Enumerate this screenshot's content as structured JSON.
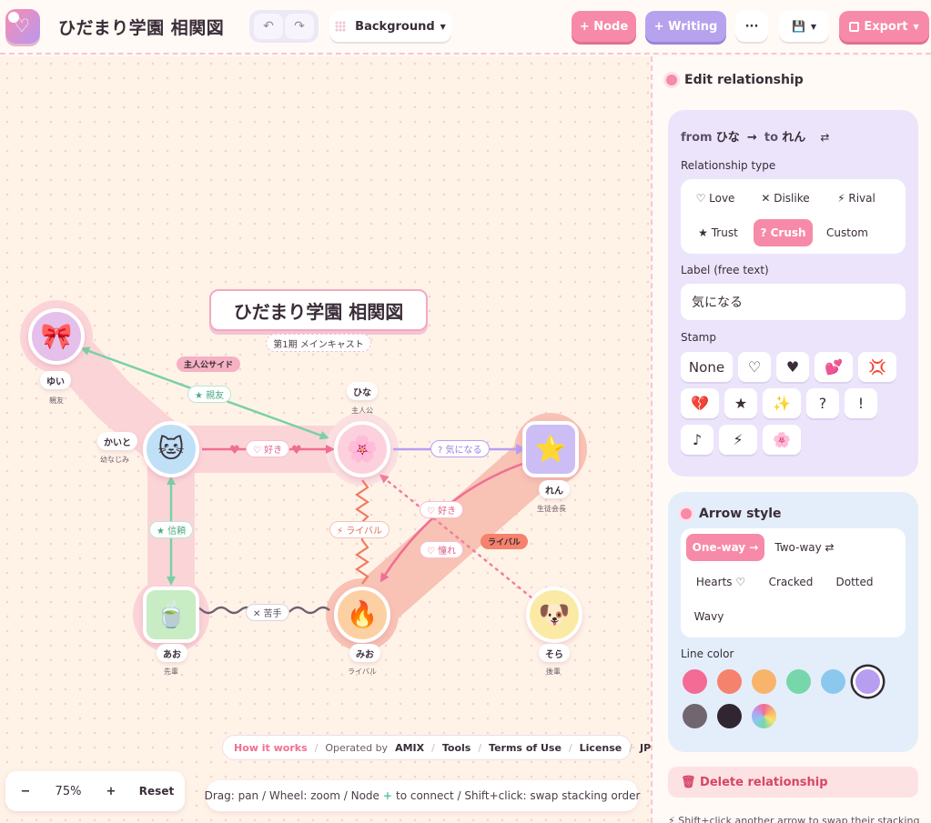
{
  "header": {
    "app_title": "ひだまり学園 相関図",
    "undo_icon": "↶",
    "redo_icon": "↷",
    "background_label": "Background",
    "add_node_label": "+ Node",
    "add_writing_label": "+ Writing",
    "more_label": "···",
    "save_icon": "💾",
    "export_label": "Export"
  },
  "canvas": {
    "title": "ひだまり学園 相関図",
    "subtitle": "第1期 メインキャスト",
    "group_labels": {
      "protagonist_side": "主人公サイド",
      "rival_group": "ライバル"
    },
    "nodes": [
      {
        "name": "ゆい",
        "sub": "親友",
        "emoji": "🎀"
      },
      {
        "name": "かいと",
        "sub": "幼なじみ",
        "emoji": "🐱"
      },
      {
        "name": "ひな",
        "sub": "主人公",
        "emoji": "🌸"
      },
      {
        "name": "れん",
        "sub": "生徒会長",
        "emoji": "⭐"
      },
      {
        "name": "あお",
        "sub": "先輩",
        "emoji": "🍵"
      },
      {
        "name": "みお",
        "sub": "ライバル",
        "emoji": "🔥"
      },
      {
        "name": "そら",
        "sub": "後輩",
        "emoji": "🐶"
      }
    ],
    "edge_labels": {
      "yui_hina": "★ 親友",
      "kaito_hina": "♡ 好き",
      "hina_ren": "? 気になる",
      "kaito_ao": "★ 信頼",
      "hina_mio": "⚡ ライバル",
      "ren_mio": "♡ 好き",
      "sora_hina": "♡ 憧れ",
      "mio_ao": "✕ 苦手"
    },
    "footer": {
      "how_it_works": "How it works",
      "operated_by": "Operated by",
      "operator": "AMIX",
      "tools": "Tools",
      "terms": "Terms of Use",
      "license": "License",
      "lang": "JP",
      "separator": "/"
    },
    "zoom": {
      "minus": "−",
      "level": "75%",
      "plus": "+",
      "reset": "Reset"
    },
    "help": {
      "before": "Drag: pan / Wheel: zoom / Node",
      "plus": "+",
      "after": "to connect / Shift+click: swap stacking order"
    }
  },
  "panel": {
    "title": "Edit relationship",
    "from_word": "from",
    "from_name": "ひな",
    "arrow": "→",
    "to_word": "to",
    "to_name": "れん",
    "swap_icon": "⇄",
    "type_label": "Relationship type",
    "types": [
      "♡ Love",
      "✕ Dislike",
      "⚡ Rival",
      "★ Trust",
      "? Crush",
      "Custom"
    ],
    "active_type": "? Crush",
    "label_title": "Label (free text)",
    "label_value": "気になる",
    "stamp_label": "Stamp",
    "stamps": [
      "None",
      "♡",
      "♥",
      "💕",
      "💢",
      "💔",
      "★",
      "✨",
      "?",
      "!",
      "♪",
      "⚡",
      "🌸"
    ],
    "arrow_style": {
      "title": "Arrow style",
      "directions": [
        "One-way →",
        "Two-way ⇄"
      ],
      "active_direction": "One-way →",
      "styles": [
        "Hearts ♡",
        "Cracked",
        "Dotted",
        "Wavy"
      ],
      "line_color_label": "Line color",
      "colors": [
        "#f46b95",
        "#f5826c",
        "#f9b46c",
        "#78d6ab",
        "#8cc8ee",
        "#b89ef0",
        "#716570",
        "#302530"
      ],
      "selected_color": "#b89ef0"
    },
    "delete_label": "🗑 Delete relationship",
    "hint": "⚡ Shift+click another arrow to swap their stacking"
  }
}
